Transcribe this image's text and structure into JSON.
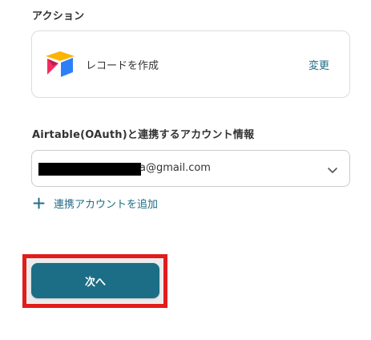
{
  "action_section": {
    "label": "アクション",
    "card": {
      "app_icon": "airtable-logo-icon",
      "action_text": "レコードを作成",
      "change_link": "変更"
    }
  },
  "account_section": {
    "label": "Airtable(OAuth)と連携するアカウント情報",
    "select": {
      "value": "a@gmail.com",
      "icon": "chevron-down-icon"
    },
    "add_account": {
      "icon": "plus-icon",
      "label": "連携アカウントを追加"
    }
  },
  "footer": {
    "next_button": "次へ"
  },
  "colors": {
    "accent": "#1c6e86",
    "link": "#216d86",
    "highlight": "#e21b1b",
    "airtable_yellow": "#fcb400",
    "airtable_blue": "#2d7ff9",
    "airtable_red": "#f82b60"
  }
}
